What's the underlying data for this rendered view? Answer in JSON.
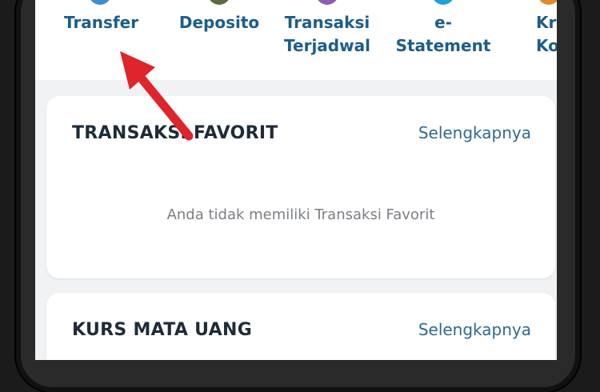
{
  "quick_menu": {
    "items": [
      {
        "label": "Transfer",
        "icon": "transfer-icon",
        "color": "#3a8fd0"
      },
      {
        "label": "Deposito",
        "icon": "deposito-icon",
        "color": "#5c6a3e"
      },
      {
        "label": "Transaksi Terjadwal",
        "icon": "scheduled-transaction-icon",
        "color": "#8e5bb3"
      },
      {
        "label": "e-Statement",
        "icon": "e-statement-icon",
        "color": "#1ea2d8"
      },
      {
        "label": "Kredit Konsumer",
        "icon": "kredit-icon",
        "color": "#e08a2e"
      }
    ]
  },
  "favorite_transactions": {
    "title": "TRANSAKSI FAVORIT",
    "link": "Selengkapnya",
    "empty_message": "Anda tidak memiliki Transaksi Favorit"
  },
  "exchange_rates": {
    "title": "KURS MATA UANG",
    "link": "Selengkapnya"
  },
  "annotation": {
    "arrow_color": "#e0242b"
  }
}
